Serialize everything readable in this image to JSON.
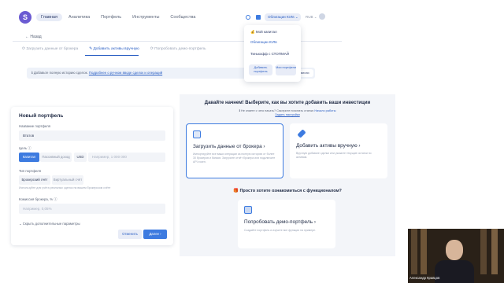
{
  "app": {
    "logo_letter": "S",
    "nav": [
      "Главная",
      "Аналитика",
      "Портфель",
      "Инструменты",
      "Сообщества"
    ],
    "portfolio_selector": "Облигации ЮЛв ⌄",
    "currency": "RUB ⌄",
    "accent_color": "#3d7be0"
  },
  "dropdown": {
    "items": [
      "💰 Мой капитал",
      "Облигации ЮЛв",
      "Тинькофф с СТОПМАЙ"
    ],
    "add_portfolio": "Добавить портфель",
    "my_portfolios": "Мои портфели"
  },
  "upper": {
    "back": "← Назад",
    "steps": [
      "⟳ Загрузить данные от брокера",
      "✎ Добавить активы вручную",
      "⟳ Попробовать демо-портфель"
    ],
    "info_text": "ℹ Добавьте полную историю сделок.",
    "info_link": "Подробнее о ручном вводе сделок и операций",
    "info_button": "Ввести"
  },
  "form": {
    "title": "Новый портфель",
    "name_label": "Название портфеля",
    "name_value": "Втатов",
    "goal_label": "Цель ⓘ",
    "goal_options": [
      "Капитал",
      "Пассивный доход"
    ],
    "currency_value": "USD",
    "goal_placeholder": "Например, 1 000 000",
    "type_label": "Тип портфеля",
    "type_options": [
      "Брокерский счёт",
      "Виртуальный счёт"
    ],
    "type_hint": "Используйте для учёта реальных сделок на вашем брокерском счёте",
    "commission_label": "Комиссия брокера, % ⓘ",
    "commission_placeholder": "Например, 0,05%",
    "more_settings": "⌄ Скрыть дополнительные параметры",
    "cancel": "Отменить",
    "next": "Далее ›"
  },
  "right": {
    "title": "Давайте начнем! Выберите, как вы хотите добавить ваши инвестиции",
    "subtitle": "ℹ Не знаете с чего начать? Смотрите почитать статью",
    "subtitle_link": "Начало работы",
    "subtitle_link2": "Задать настройки",
    "cards": [
      {
        "title": "Загрузить данные от брокера ›",
        "desc": "Импортируйте все ваши операции за полную историю от более 30 брокеров и банков. Загрузите отчёт брокера или подключите API-токен."
      },
      {
        "title": "Добавить активы вручную ›",
        "desc": "Вручную добавьте сделки или укажите текущие остатки по активам."
      }
    ],
    "demo_heading": "🎁 Просто хотите ознакомиться с функционалом?",
    "demo_card": {
      "title": "Попробовать демо-портфель ›",
      "desc": "Создайте портфель и изучите все функции на примере."
    }
  },
  "video": {
    "caption": "Александр Кравцов"
  }
}
